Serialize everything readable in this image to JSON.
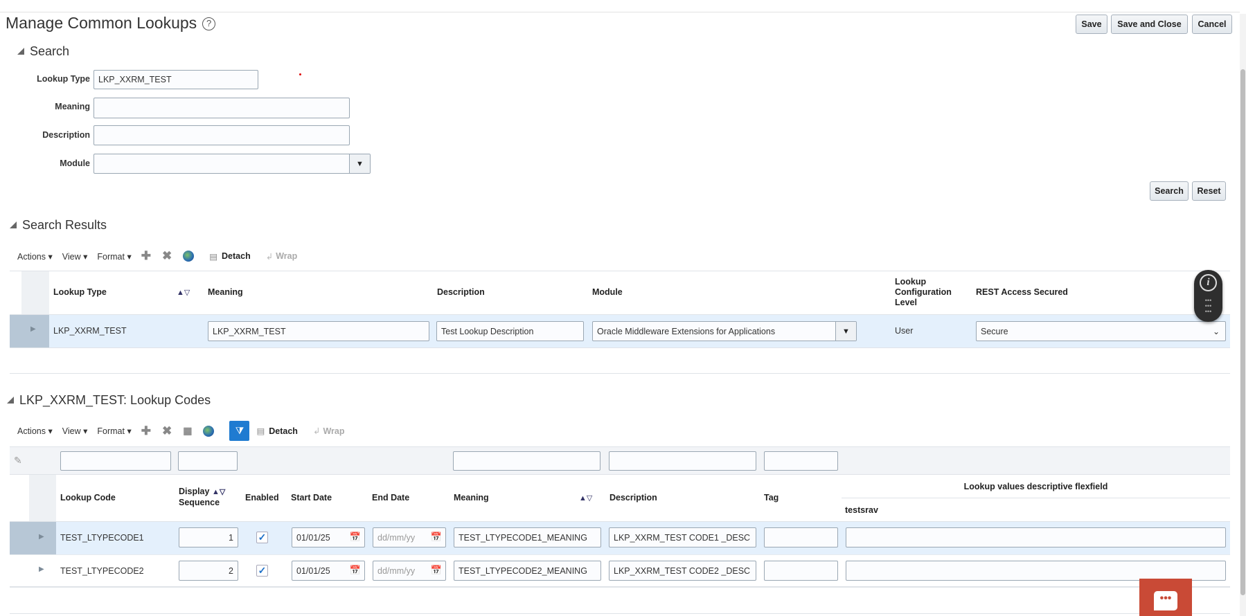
{
  "page": {
    "title": "Manage Common Lookups",
    "help_icon": "?"
  },
  "actions": {
    "save": "Save",
    "save_close": "Save and Close",
    "cancel": "Cancel"
  },
  "search": {
    "heading": "Search",
    "fields": {
      "lookup_type_label": "Lookup Type",
      "lookup_type_value": "LKP_XXRM_TEST",
      "meaning_label": "Meaning",
      "meaning_value": "",
      "description_label": "Description",
      "description_value": "",
      "module_label": "Module",
      "module_value": ""
    },
    "search_btn": "Search",
    "reset_btn": "Reset"
  },
  "toolbar": {
    "actions": "Actions",
    "view": "View",
    "format": "Format",
    "detach": "Detach",
    "wrap": "Wrap"
  },
  "results": {
    "heading": "Search Results",
    "columns": {
      "lookup_type": "Lookup Type",
      "meaning": "Meaning",
      "description": "Description",
      "module": "Module",
      "config_level_1": "Lookup",
      "config_level_2": "Configuration",
      "config_level_3": "Level",
      "rest": "REST Access Secured"
    },
    "rows": [
      {
        "lookup_type": "LKP_XXRM_TEST",
        "meaning": "LKP_XXRM_TEST",
        "description": "Test Lookup Description",
        "module": "Oracle Middleware Extensions for Applications",
        "config_level": "User",
        "rest": "Secure"
      }
    ]
  },
  "codes": {
    "heading": "LKP_XXRM_TEST: Lookup Codes",
    "columns": {
      "lookup_code": "Lookup Code",
      "display_seq_1": "Display",
      "display_seq_2": "Sequence",
      "enabled": "Enabled",
      "start_date": "Start Date",
      "end_date": "End Date",
      "meaning": "Meaning",
      "description": "Description",
      "tag": "Tag",
      "dff": "Lookup values descriptive flexfield",
      "dff_sub": "testsrav"
    },
    "date_placeholder": "dd/mm/yy",
    "rows": [
      {
        "lookup_code": "TEST_LTYPECODE1",
        "seq": "1",
        "enabled": true,
        "start_date": "01/01/25",
        "end_date": "",
        "meaning": "TEST_LTYPECODE1_MEANING",
        "description": "LKP_XXRM_TEST CODE1 _DESC",
        "tag": "",
        "testsrav": ""
      },
      {
        "lookup_code": "TEST_LTYPECODE2",
        "seq": "2",
        "enabled": true,
        "start_date": "01/01/25",
        "end_date": "",
        "meaning": "TEST_LTYPECODE2_MEANING",
        "description": "LKP_XXRM_TEST CODE2 _DESC",
        "tag": "",
        "testsrav": ""
      }
    ]
  },
  "colors": {
    "accent": "#1f7bd1",
    "selected_row": "#e4f0fc",
    "chat": "#c94a36"
  }
}
